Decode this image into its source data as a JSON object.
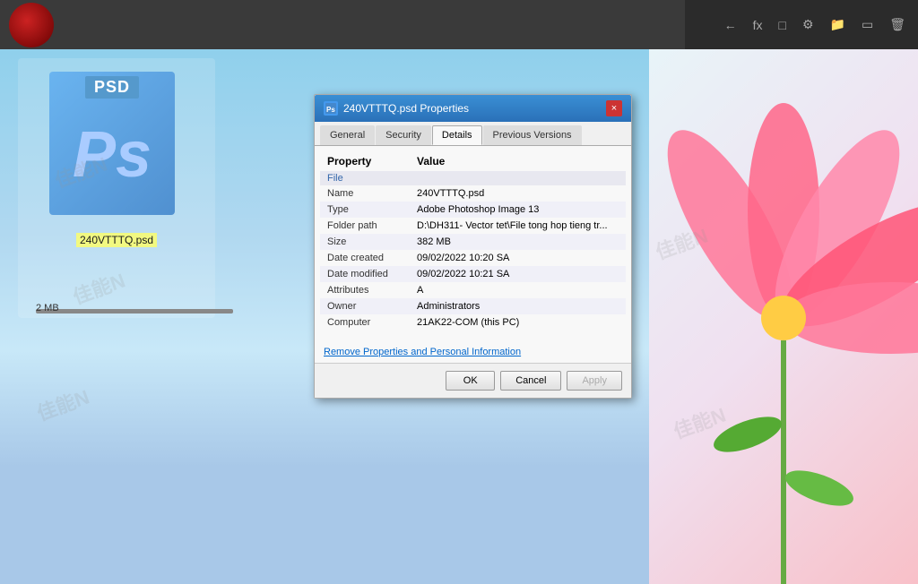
{
  "app": {
    "title": "240VTTTQ.psd Properties"
  },
  "topbar": {
    "icons": [
      "←",
      "fx",
      "◻",
      "⚙",
      "🗂",
      "⬚",
      "🗑"
    ]
  },
  "desktop": {
    "file_icon": {
      "type_label": "PSD",
      "ps_letter": "Ps",
      "name": "240VTTTQ.psd",
      "size": "2 MB"
    }
  },
  "dialog": {
    "title": "240VTTTQ.psd Properties",
    "close_btn": "×",
    "tabs": [
      {
        "label": "General",
        "active": false
      },
      {
        "label": "Security",
        "active": false
      },
      {
        "label": "Details",
        "active": true
      },
      {
        "label": "Previous Versions",
        "active": false
      }
    ],
    "table": {
      "col_property": "Property",
      "col_value": "Value",
      "section_file": "File",
      "rows": [
        {
          "property": "Name",
          "value": "240VTTTQ.psd"
        },
        {
          "property": "Type",
          "value": "Adobe Photoshop Image 13"
        },
        {
          "property": "Folder path",
          "value": "D:\\DH311- Vector tet\\File tong hop tieng tr..."
        },
        {
          "property": "Size",
          "value": "382 MB"
        },
        {
          "property": "Date created",
          "value": "09/02/2022 10:20 SA"
        },
        {
          "property": "Date modified",
          "value": "09/02/2022 10:21 SA"
        },
        {
          "property": "Attributes",
          "value": "A"
        },
        {
          "property": "Owner",
          "value": "Administrators"
        },
        {
          "property": "Computer",
          "value": "21AK22-COM (this PC)"
        }
      ]
    },
    "link_text": "Remove Properties and Personal Information",
    "buttons": {
      "ok": "OK",
      "cancel": "Cancel",
      "apply": "Apply"
    }
  }
}
